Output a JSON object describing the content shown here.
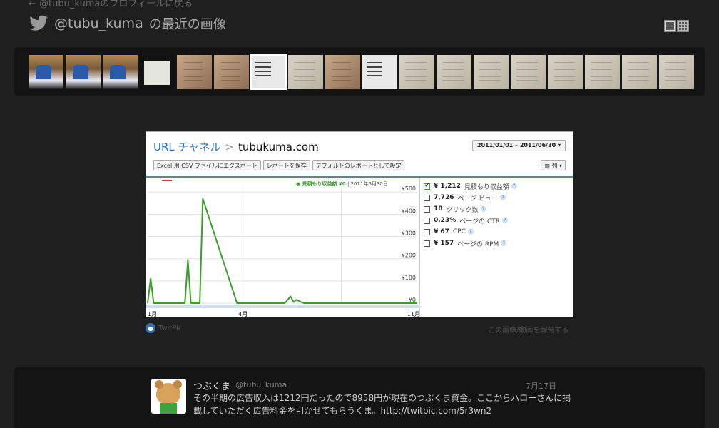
{
  "header": {
    "back_link": "← @tubu_kumaのプロフィールに戻る",
    "handle": "@tubu_kuma",
    "title_suffix": "の最近の画像"
  },
  "icons": {
    "twitter": "bird-icon",
    "view_list": "list-view-icon",
    "view_grid": "grid-view-icon",
    "twitpic": "twitpic-icon"
  },
  "thumbnails": [
    {
      "kind": "game",
      "selected": false
    },
    {
      "kind": "game",
      "selected": false
    },
    {
      "kind": "game",
      "selected": false
    },
    {
      "kind": "dark",
      "selected": false
    },
    {
      "kind": "warm",
      "selected": false
    },
    {
      "kind": "warm",
      "selected": false
    },
    {
      "kind": "screen",
      "selected": true
    },
    {
      "kind": "paper",
      "selected": false
    },
    {
      "kind": "warm",
      "selected": false
    },
    {
      "kind": "screen",
      "selected": false
    },
    {
      "kind": "paper",
      "selected": false
    },
    {
      "kind": "paper",
      "selected": false
    },
    {
      "kind": "paper",
      "selected": false
    },
    {
      "kind": "paper",
      "selected": false
    },
    {
      "kind": "paper",
      "selected": false
    },
    {
      "kind": "paper",
      "selected": false
    },
    {
      "kind": "paper",
      "selected": false
    },
    {
      "kind": "paper",
      "selected": false
    }
  ],
  "photo": {
    "crumb_root": "URL チャネル",
    "crumb_sep": ">",
    "crumb_site": "tubukuma.com",
    "date_range": "2011/01/01 – 2011/06/30 ▾",
    "buttons": [
      "Excel 用 CSV ファイルにエクスポート",
      "レポートを保存",
      "デフォルトのレポートとして設定"
    ],
    "columns_button": "▥ 列 ▾",
    "legend_series": "● 見積もり収益額 ¥0",
    "legend_date": "| 2011年6月30日",
    "metrics": [
      {
        "checked": true,
        "value": "¥ 1,212",
        "label": "見積もり収益額"
      },
      {
        "checked": false,
        "value": "7,726",
        "label": "ページ ビュー"
      },
      {
        "checked": false,
        "value": "18",
        "label": "クリック数"
      },
      {
        "checked": false,
        "value": "0.23%",
        "label": "ページの CTR"
      },
      {
        "checked": false,
        "value": "¥ 67",
        "label": "CPC"
      },
      {
        "checked": false,
        "value": "¥ 157",
        "label": "ページの RPM"
      }
    ],
    "help_glyph": "?"
  },
  "chart_data": {
    "type": "line",
    "title": "",
    "xlabel": "",
    "ylabel": "",
    "x_ticks": [
      "1月",
      "4月",
      "11月"
    ],
    "y_ticks": [
      "¥500",
      "¥400",
      "¥300",
      "¥200",
      "¥100",
      "¥0"
    ],
    "ylim": [
      0,
      520
    ],
    "series": [
      {
        "name": "見積もり収益額",
        "color": "#3aa02a",
        "x": [
          0,
          2,
          4,
          6,
          25,
          27,
          29,
          31,
          33,
          35,
          37,
          60,
          62,
          64,
          66,
          88,
          90,
          92,
          94,
          96,
          98,
          100,
          103,
          105,
          107,
          109,
          111,
          130,
          132,
          134,
          136,
          138,
          181
        ],
        "values": [
          0,
          110,
          0,
          0,
          0,
          195,
          0,
          0,
          0,
          0,
          470,
          0,
          0,
          0,
          0,
          0,
          0,
          0,
          15,
          30,
          5,
          15,
          5,
          0,
          0,
          0,
          0,
          0,
          0,
          0,
          0,
          0,
          0
        ]
      }
    ]
  },
  "source": {
    "name": "TwitPic",
    "report": "この画像/動画を報告する"
  },
  "tweet": {
    "name": "つぶくま",
    "handle": "@tubu_kuma",
    "date": "7月17日",
    "text": "その半期の広告収入は1212円だったので8958円が現在のつぶくま資金。ここからハローさんに掲載していただく広告料金を引かせてもらうくま。http://twitpic.com/5r3wn2"
  },
  "colors": {
    "background": "#1f1f1f",
    "panel": "#141414",
    "link_blue": "#2a6fc2",
    "series_green": "#3aa02a"
  }
}
